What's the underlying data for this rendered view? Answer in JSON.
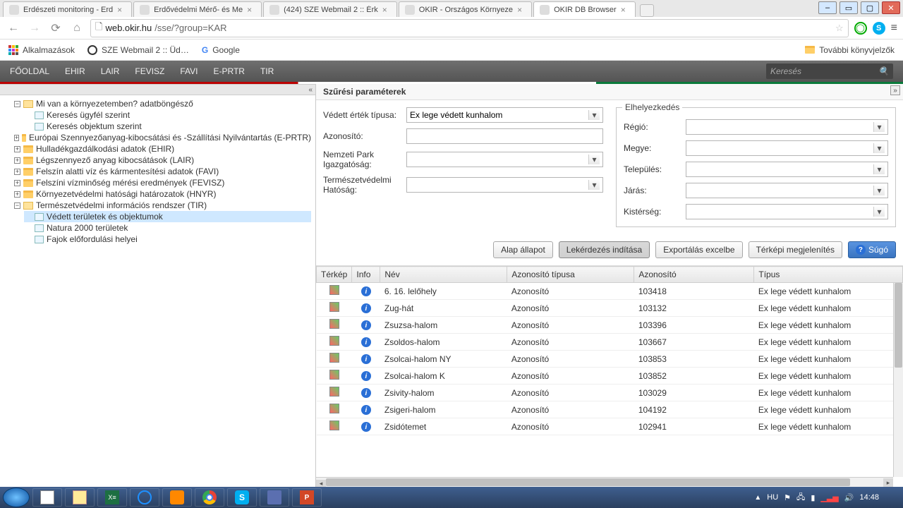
{
  "browser": {
    "tabs": [
      {
        "label": "Erdészeti monitoring - Erd"
      },
      {
        "label": "Erdővédelmi Mérő- és Me"
      },
      {
        "label": "(424) SZE Webmail 2 :: Érk"
      },
      {
        "label": "OKIR - Országos Környeze"
      },
      {
        "label": "OKIR DB Browser",
        "active": true
      }
    ],
    "url_host": "web.okir.hu",
    "url_path": "/sse/?group=KAR"
  },
  "bookmarks": {
    "apps": "Alkalmazások",
    "sze": "SZE Webmail 2 :: Üd…",
    "google": "Google",
    "more": "További könyvjelzők"
  },
  "menu": [
    "FŐOLDAL",
    "EHIR",
    "LAIR",
    "FEVISZ",
    "FAVI",
    "E-PRTR",
    "TIR"
  ],
  "search_placeholder": "Keresés",
  "tree": {
    "root": "Mi van a környezetemben? adatböngésző",
    "root_children": [
      "Keresés ügyfél szerint",
      "Keresés objektum szerint"
    ],
    "folders": [
      "Európai Szennyezőanyag-kibocsátási és -Szállítási Nyilvántartás (E-PRTR)",
      "Hulladékgazdálkodási adatok (EHIR)",
      "Légszennyező anyag kibocsátások (LAIR)",
      "Felszín alatti víz és kármentesítési adatok (FAVI)",
      "Felszíni vízminőség mérési eredmények (FEVISZ)",
      "Környezetvédelmi hatósági határozatok (HNYR)"
    ],
    "tir": "Természetvédelmi információs rendszer (TIR)",
    "tir_children": [
      "Védett területek és objektumok",
      "Natura 2000 területek",
      "Fajok előfordulási helyei"
    ]
  },
  "filters": {
    "title": "Szűrési paraméterek",
    "labels": {
      "vetipus": "Védett érték típusa:",
      "azon": "Azonosító:",
      "npi": "Nemzeti Park Igazgatóság:",
      "th": "Természetvédelmi Hatóság:"
    },
    "vetipus_value": "Ex lege védett kunhalom",
    "loc_legend": "Elhelyezkedés",
    "loc_labels": {
      "regio": "Régió:",
      "megye": "Megye:",
      "telep": "Település:",
      "jaras": "Járás:",
      "kister": "Kistérség:"
    }
  },
  "buttons": {
    "alap": "Alap állapot",
    "lek": "Lekérdezés indítása",
    "exp": "Exportálás excelbe",
    "terk": "Térképi megjelenítés",
    "sugo": "Súgó"
  },
  "table": {
    "headers": [
      "Térkép",
      "Info",
      "Név",
      "Azonosító típusa",
      "Azonosító",
      "Típus"
    ],
    "rows": [
      {
        "nev": "6. 16. lelőhely",
        "tip": "Azonosító",
        "az": "103418",
        "t": "Ex lege védett kunhalom"
      },
      {
        "nev": "Zug-hát",
        "tip": "Azonosító",
        "az": "103132",
        "t": "Ex lege védett kunhalom"
      },
      {
        "nev": "Zsuzsa-halom",
        "tip": "Azonosító",
        "az": "103396",
        "t": "Ex lege védett kunhalom"
      },
      {
        "nev": "Zsoldos-halom",
        "tip": "Azonosító",
        "az": "103667",
        "t": "Ex lege védett kunhalom"
      },
      {
        "nev": "Zsolcai-halom NY",
        "tip": "Azonosító",
        "az": "103853",
        "t": "Ex lege védett kunhalom"
      },
      {
        "nev": "Zsolcai-halom K",
        "tip": "Azonosító",
        "az": "103852",
        "t": "Ex lege védett kunhalom"
      },
      {
        "nev": "Zsivity-halom",
        "tip": "Azonosító",
        "az": "103029",
        "t": "Ex lege védett kunhalom"
      },
      {
        "nev": "Zsigeri-halom",
        "tip": "Azonosító",
        "az": "104192",
        "t": "Ex lege védett kunhalom"
      },
      {
        "nev": "Zsidótemet",
        "tip": "Azonosító",
        "az": "102941",
        "t": "Ex lege védett kunhalom"
      }
    ]
  },
  "tray": {
    "lang": "HU",
    "time": "14:48"
  }
}
